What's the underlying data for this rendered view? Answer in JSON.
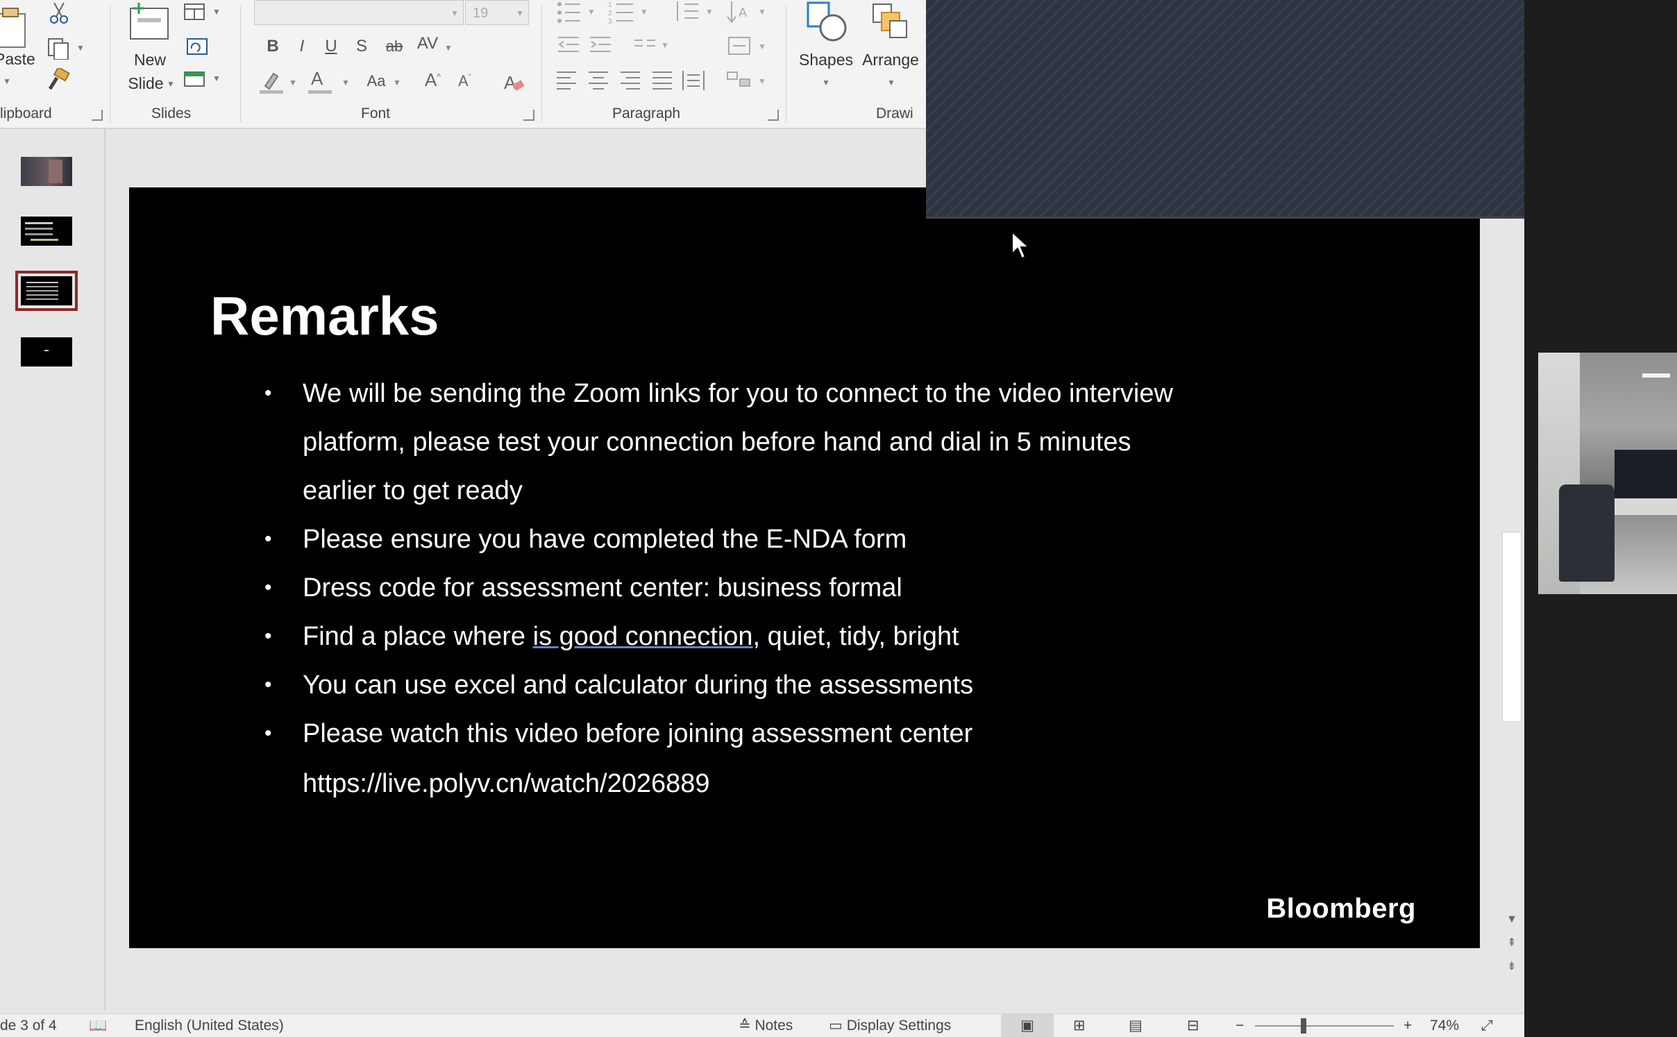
{
  "ribbon": {
    "groups": {
      "clipboard": "lipboard",
      "slides": "Slides",
      "font": "Font",
      "paragraph": "Paragraph",
      "drawing": "Drawi"
    },
    "paste_label": "Paste",
    "new_slide_line1": "New",
    "new_slide_line2": "Slide",
    "font_name_value": "",
    "font_size_value": "19",
    "shapes_label": "Shapes",
    "arrange_label": "Arrange",
    "format_buttons": [
      "B",
      "I",
      "U",
      "S",
      "ab",
      "AV"
    ],
    "case_label": "Aa"
  },
  "thumbnails": {
    "count": 4,
    "selected_index": 3
  },
  "slide": {
    "title": "Remarks",
    "bullets": [
      "We will be sending the Zoom links for you to connect to the video interview platform, please test your connection before hand and dial in 5 minutes earlier to get ready",
      "Please ensure you have completed the E-NDA form",
      "Dress code for assessment center: business formal",
      {
        "before": "Find a place where ",
        "underlined": "is good connection",
        "after": ", quiet, tidy, bright"
      },
      "You can use excel and calculator during the assessments",
      "Please watch this video before joining assessment center"
    ],
    "url": "https://live.polyv.cn/watch/2026889",
    "logo": "Bloomberg"
  },
  "status_bar": {
    "slide_indicator": "de 3 of 4",
    "language": "English (United States)",
    "notes": "Notes",
    "display_settings": "Display Settings",
    "zoom": "74%"
  },
  "colors": {
    "ribbon_bg": "#f3f3f3",
    "slide_bg": "#000000",
    "selected_thumb": "#8a2a2a",
    "overlay": "#2e3542"
  }
}
